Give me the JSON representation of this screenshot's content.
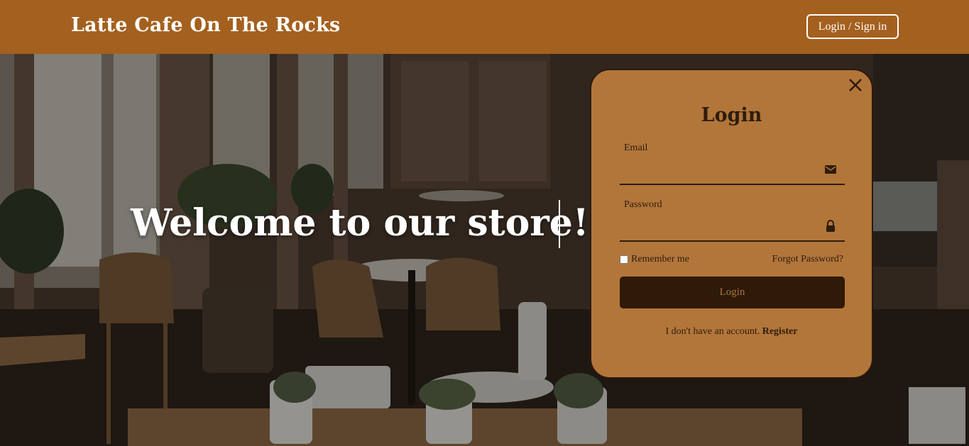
{
  "header": {
    "brand": "Latte Cafe On The Rocks",
    "login_signin": "Login / Sign in"
  },
  "hero": {
    "welcome": "Welcome to our store!"
  },
  "login_panel": {
    "title": "Login",
    "email_label": "Email",
    "email_value": "",
    "password_label": "Password",
    "password_value": "",
    "remember_me": "Remember me",
    "remember_checked": false,
    "forgot_password": "Forgot Password?",
    "submit_label": "Login",
    "no_account_text": "I don't have an account.",
    "register_link": "Register"
  },
  "icons": {
    "close": "close-icon",
    "email": "mail-icon",
    "password": "lock-icon"
  },
  "colors": {
    "header_bg": "#a4601e",
    "panel_bg": "#b2763a",
    "panel_border": "#2c1a0c",
    "button_bg": "#2e1a07",
    "button_text": "#a77545",
    "text_dark": "#2e1c0e"
  }
}
